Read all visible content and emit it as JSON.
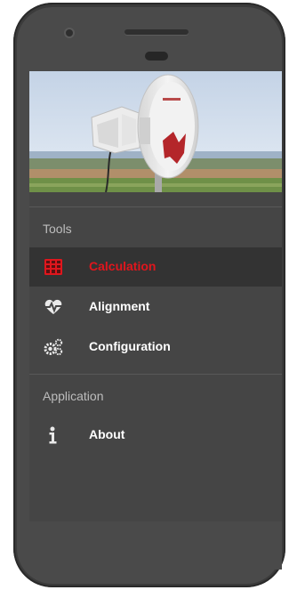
{
  "drawer": {
    "sections": [
      {
        "label": "Tools",
        "items": [
          {
            "label": "Calculation",
            "icon": "calculator-icon",
            "active": true
          },
          {
            "label": "Alignment",
            "icon": "heart-pulse-icon",
            "active": false
          },
          {
            "label": "Configuration",
            "icon": "gears-icon",
            "active": false
          }
        ]
      },
      {
        "label": "Application",
        "items": [
          {
            "label": "About",
            "icon": "info-icon",
            "active": false
          }
        ]
      }
    ]
  },
  "colors": {
    "accent": "#e0161d",
    "drawer_background": "#454545",
    "active_row": "#333333",
    "text": "#ffffff",
    "section_text": "#bdbdbd"
  }
}
